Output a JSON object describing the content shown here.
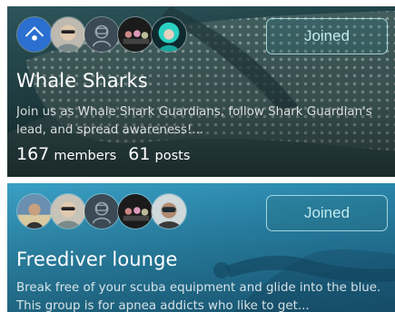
{
  "groups": [
    {
      "title": "Whale Sharks",
      "description": "Join us as Whale Shark Guardians, follow Shark Guardian's lead, and spread awareness!...",
      "members_count": "167",
      "members_label": "members",
      "posts_count": "61",
      "posts_label": "posts",
      "button_label": "Joined",
      "avatars": [
        "dive-logo-avatar",
        "member-avatar-sunglasses",
        "diver-placeholder-avatar",
        "divers-group-avatar",
        "teal-hair-avatar"
      ]
    },
    {
      "title": "Freediver lounge",
      "description": "Break free of your scuba equipment and glide into the blue. This group is for apnea addicts who like to get...",
      "button_label": "Joined",
      "avatars": [
        "member-avatar-beach",
        "member-avatar-sunglasses",
        "diver-placeholder-avatar",
        "divers-group-avatar",
        "diver-mask-avatar"
      ]
    }
  ],
  "colors": {
    "button_text": "#bfe9ee",
    "button_border": "#afe1e6",
    "card1_bg": "#1f3a3e",
    "card2_bg": "#2f8cb0"
  }
}
